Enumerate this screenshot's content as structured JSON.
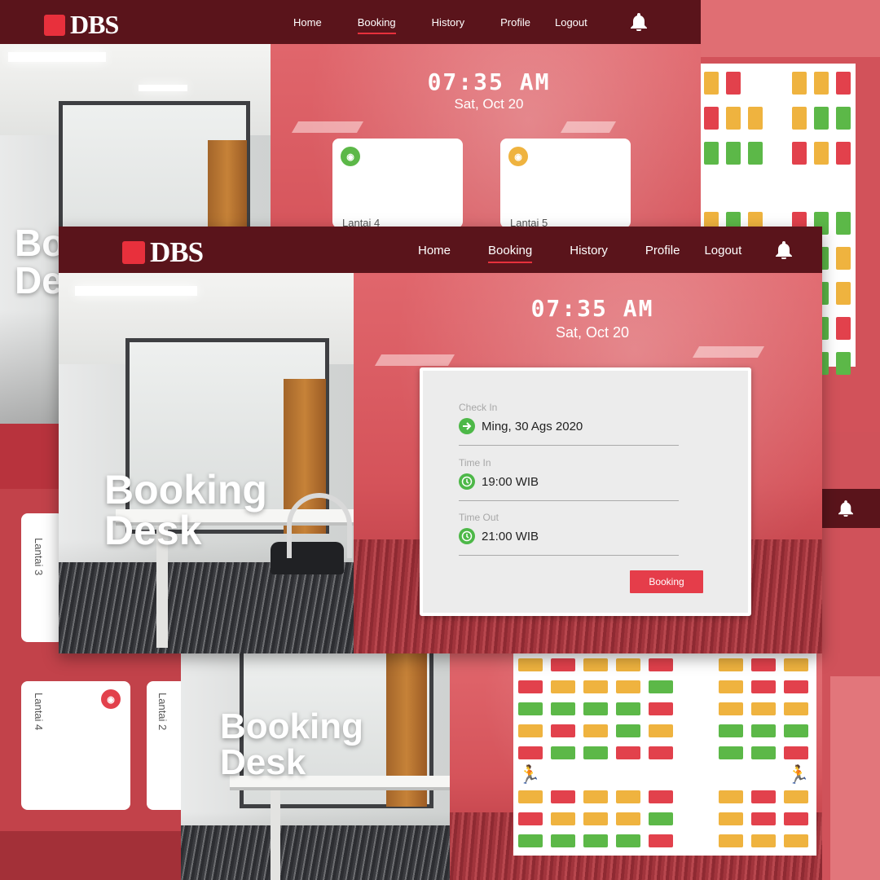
{
  "brand": {
    "logo_text": "DBS",
    "accent": "#e8303c",
    "nav_bg": "#5a141b"
  },
  "nav": {
    "items": [
      {
        "label": "Home"
      },
      {
        "label": "Booking",
        "active": true
      },
      {
        "label": "History"
      },
      {
        "label": "Profile"
      },
      {
        "label": "Logout"
      }
    ],
    "bell_icon": "bell-icon"
  },
  "clock": {
    "time": "07:35 AM",
    "date": "Sat, Oct 20"
  },
  "hero": {
    "line1": "Booking",
    "line2": "Desk",
    "partial_line1": "Bo",
    "partial_line2": "De"
  },
  "floors": {
    "lantai3": "Lantai 3",
    "lantai4": "Lantai 4",
    "lantai2": "Lantai 2",
    "lantai4_short": "Lantai 4",
    "lantai5_short": "Lantai 5"
  },
  "booking_form": {
    "check_in_label": "Check In",
    "check_in_value": "Ming, 30 Ags 2020",
    "time_in_label": "Time In",
    "time_in_value": "19:00 WIB",
    "time_out_label": "Time Out",
    "time_out_value": "21:00 WIB",
    "submit_label": "Booking"
  },
  "seat_status_colors": {
    "available": "#5cb848",
    "partial": "#efb33f",
    "booked": "#e2414c"
  }
}
